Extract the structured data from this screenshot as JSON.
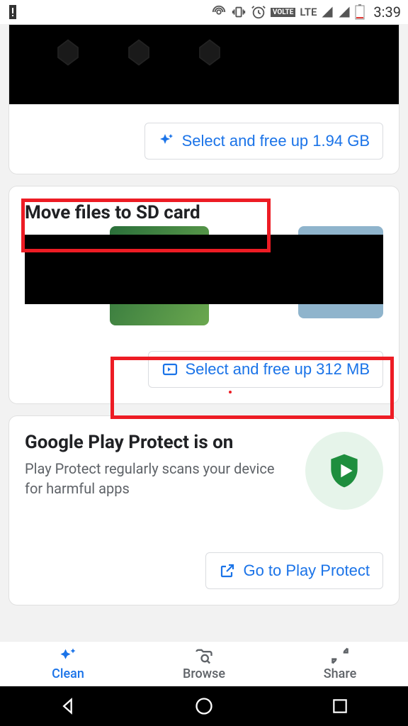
{
  "status": {
    "lte": "LTE",
    "volte": "VOLTE",
    "time": "3:39"
  },
  "card1": {
    "button_label": "Select and free up 1.94 GB"
  },
  "card2": {
    "title": "Move files to SD card",
    "button_label": "Select and free up 312 MB"
  },
  "card3": {
    "title": "Google Play Protect is on",
    "desc": "Play Protect regularly scans your device for harmful apps",
    "button_label": "Go to Play Protect"
  },
  "nav": {
    "clean": "Clean",
    "browse": "Browse",
    "share": "Share"
  }
}
